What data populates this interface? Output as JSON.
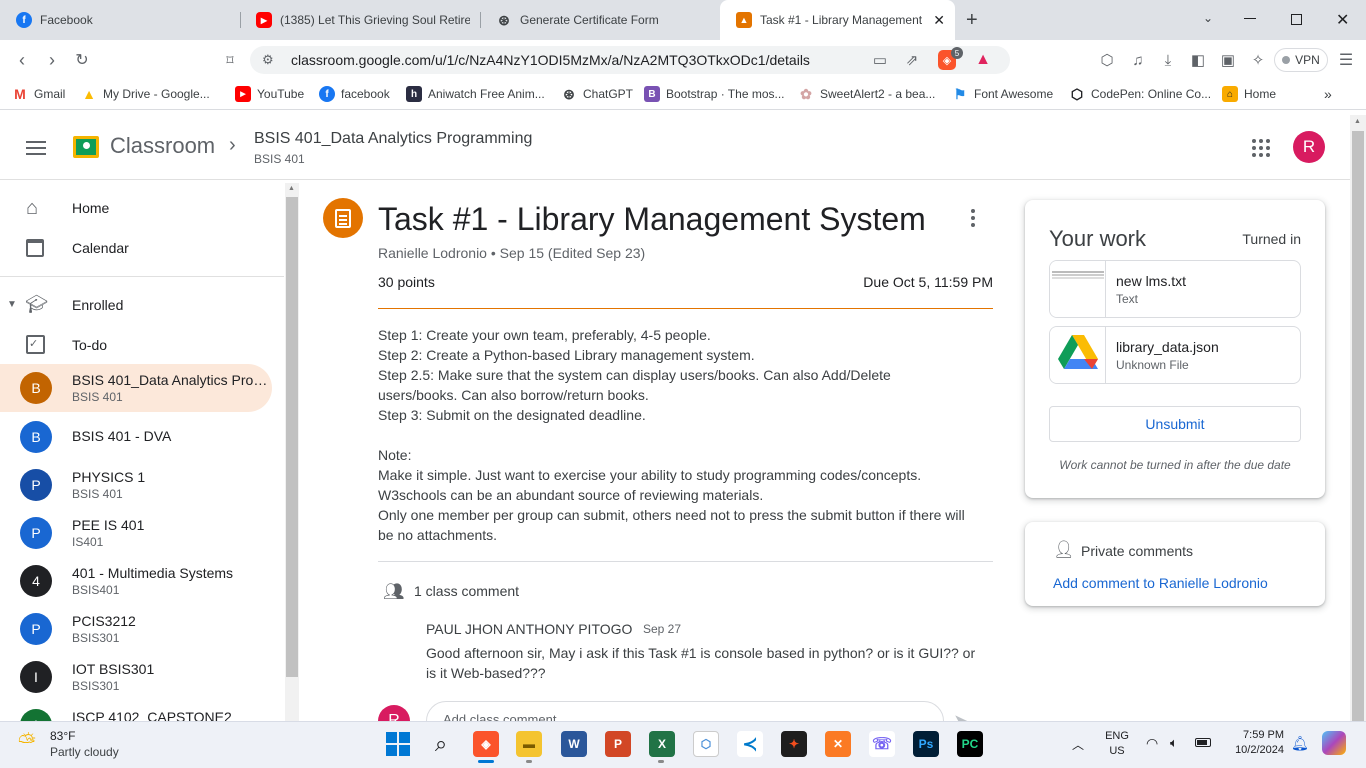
{
  "browser": {
    "tabs": [
      {
        "title": "Facebook",
        "icon": "facebook-icon"
      },
      {
        "title": "(1385) Let This Grieving Soul Retire",
        "icon": "youtube-icon"
      },
      {
        "title": "Generate Certificate Form",
        "icon": "chatgpt-icon"
      },
      {
        "title": "Task #1 - Library Management",
        "icon": "classroom-icon"
      }
    ],
    "url": "classroom.google.com/u/1/c/NzA4NzY1ODI5MzMx/a/NzA2MTQ3OTkxODc1/details",
    "extension_badge": "5",
    "vpn_label": "VPN",
    "bookmarks": [
      "Gmail",
      "My Drive - Google...",
      "YouTube",
      "facebook",
      "Aniwatch Free Anim...",
      "ChatGPT",
      "Bootstrap · The mos...",
      "SweetAlert2 - a bea...",
      "Font Awesome",
      "CodePen: Online Co...",
      "Home"
    ]
  },
  "appbar": {
    "product": "Classroom",
    "course_title": "BSIS 401_Data Analytics Programming",
    "course_code": "BSIS 401",
    "avatar_letter": "R"
  },
  "sidebar": {
    "home": "Home",
    "calendar": "Calendar",
    "enrolled": "Enrolled",
    "todo": "To-do",
    "classes": [
      {
        "letter": "B",
        "name": "BSIS 401_Data Analytics Programming",
        "code": "BSIS 401",
        "color": "#c26401",
        "selected": true
      },
      {
        "letter": "B",
        "name": "BSIS 401 - DVA",
        "code": "",
        "color": "#1967d2",
        "selected": false
      },
      {
        "letter": "P",
        "name": "PHYSICS 1",
        "code": "BSIS 401",
        "color": "#174ea6",
        "selected": false
      },
      {
        "letter": "P",
        "name": "PEE IS 401",
        "code": "IS401",
        "color": "#1967d2",
        "selected": false
      },
      {
        "letter": "4",
        "name": "401 - Multimedia Systems",
        "code": "BSIS401",
        "color": "#202124",
        "selected": false
      },
      {
        "letter": "P",
        "name": "PCIS3212",
        "code": "BSIS301",
        "color": "#1967d2",
        "selected": false
      },
      {
        "letter": "I",
        "name": "IOT BSIS301",
        "code": "BSIS301",
        "color": "#202124",
        "selected": false
      },
      {
        "letter": "I",
        "name": "ISCP 4102_CAPSTONE2",
        "code": "",
        "color": "#137333",
        "selected": false
      }
    ]
  },
  "assignment": {
    "title": "Task #1 - Library Management System",
    "meta": "Ranielle Lodronio • Sep 15 (Edited Sep 23)",
    "points": "30 points",
    "due": "Due Oct 5, 11:59 PM",
    "body": [
      "Step 1: Create your own team, preferably, 4-5 people.",
      "Step 2: Create a Python-based Library management system.",
      "Step 2.5: Make sure that the system can display users/books. Can also Add/Delete",
      "users/books. Can also borrow/return books.",
      "Step 3: Submit on the designated deadline.",
      "",
      "Note:",
      "Make it simple. Just want to exercise your ability to study programming codes/concepts.",
      "W3schools can be an abundant source of reviewing materials.",
      "Only one member per group can submit, others need not to press the submit button if there will",
      "be no attachments."
    ],
    "comments_header": "1 class comment",
    "comment": {
      "author": "PAUL JHON ANTHONY PITOGO",
      "date": "Sep 27",
      "text_line1": "Good afternoon sir, May i ask if this Task #1 is console based in python? or is it GUI?? or",
      "text_line2": "is it Web-based???"
    },
    "comment_placeholder": "Add class comment..."
  },
  "your_work": {
    "title": "Your work",
    "status": "Turned in",
    "files": [
      {
        "name": "new lms.txt",
        "type": "Text"
      },
      {
        "name": "library_data.json",
        "type": "Unknown File"
      }
    ],
    "unsubmit_label": "Unsubmit",
    "note": "Work cannot be turned in after the due date"
  },
  "private_comments": {
    "title": "Private comments",
    "link": "Add comment to Ranielle Lodronio"
  },
  "taskbar": {
    "weather_temp": "83°F",
    "weather_desc": "Partly cloudy",
    "lang1": "ENG",
    "lang2": "US",
    "time": "7:59 PM",
    "date": "10/2/2024"
  },
  "colors": {
    "accent_orange": "#e37400",
    "link_blue": "#1967d2",
    "avatar_pink": "#d81b60"
  }
}
